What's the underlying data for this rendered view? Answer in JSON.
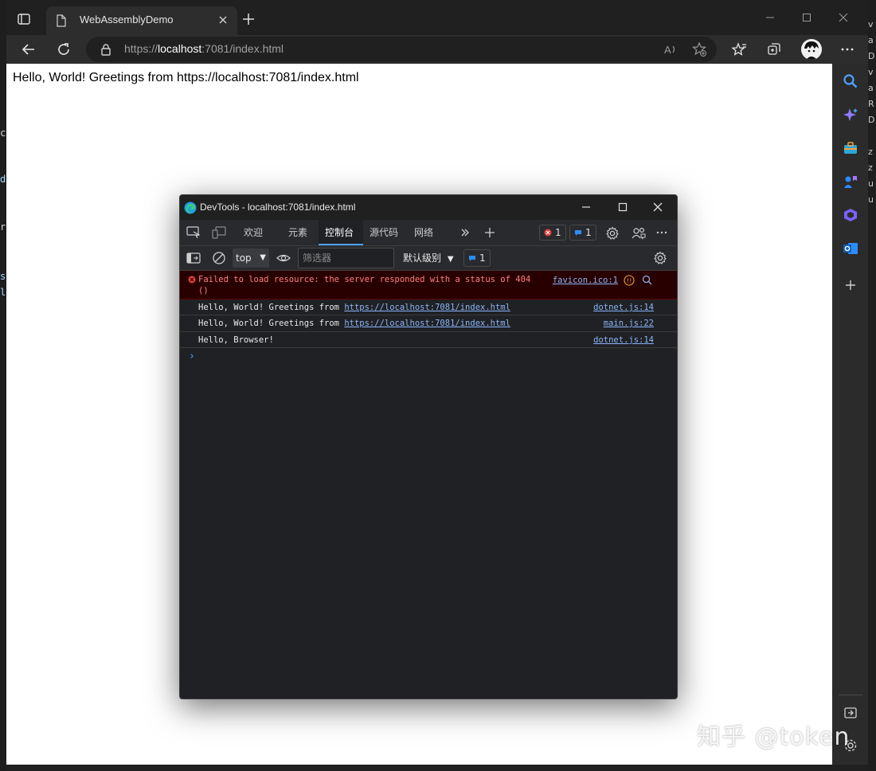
{
  "browser": {
    "tab_title": "WebAssemblyDemo",
    "url_prefix": "https://",
    "url_host": "localhost",
    "url_rest": ":7081/index.html"
  },
  "page": {
    "text": "Hello, World! Greetings from https://localhost:7081/index.html"
  },
  "devtools": {
    "window_title": "DevTools - localhost:7081/index.html",
    "tabs": [
      {
        "label": "欢迎"
      },
      {
        "label": "元素"
      },
      {
        "label": "控制台",
        "active": true
      },
      {
        "label": "源代码"
      },
      {
        "label": "网络"
      }
    ],
    "error_count": "1",
    "info_count": "1",
    "context": "top",
    "filter_placeholder": "筛选器",
    "levels_label": "默认级别",
    "filter_info_count": "1",
    "messages": [
      {
        "type": "error",
        "text": "Failed to load resource: the server responded with a status of 404",
        "text2": "()",
        "source": "favicon.ico:1"
      },
      {
        "type": "log",
        "prefix": "Hello, World! Greetings from ",
        "link": "https://localhost:7081/index.html",
        "source": "dotnet.js:14"
      },
      {
        "type": "log",
        "prefix": "Hello, World! Greetings from ",
        "link": "https://localhost:7081/index.html",
        "source": "main.js:22"
      },
      {
        "type": "log",
        "prefix": "Hello, Browser!",
        "source": "dotnet.js:14"
      }
    ]
  },
  "watermark": "知乎 @token",
  "colors": {
    "accent": "#4da3ff",
    "error_text": "#ff8080",
    "link": "#8ab4f8"
  }
}
